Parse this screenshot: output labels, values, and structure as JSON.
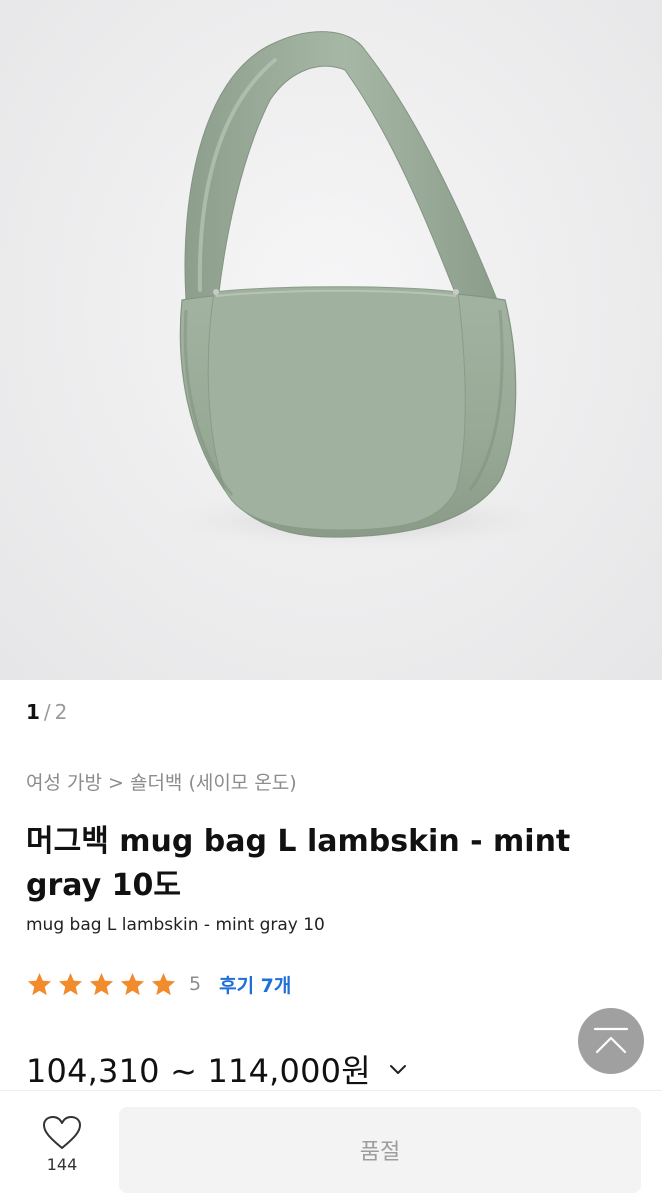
{
  "gallery": {
    "image_alt": "mint gray lambskin mug bag",
    "current_page": "1",
    "separator": "/",
    "total_pages": "2"
  },
  "product": {
    "breadcrumb": "여성 가방 > 숄더백 (세이모 온도)",
    "title": "머그백 mug bag L lambskin - mint gray 10도",
    "subtitle": "mug bag L lambskin - mint gray 10",
    "rating": {
      "stars": 5,
      "score": "5",
      "review_label": "후기 7개"
    },
    "price": "104,310 ~ 114,000원"
  },
  "bottom_bar": {
    "like_count": "144",
    "soldout_label": "품절"
  },
  "colors": {
    "star": "#f28b2c",
    "review_link": "#1f6fd8",
    "bag": "#9aab99",
    "scroll_top_bg": "#9b9b9b",
    "soldout_bg": "#f3f3f4"
  },
  "icons": {
    "star": "star-icon",
    "chevron": "chevron-down-icon",
    "scroll_top": "scroll-to-top-icon",
    "like": "heart-icon"
  }
}
